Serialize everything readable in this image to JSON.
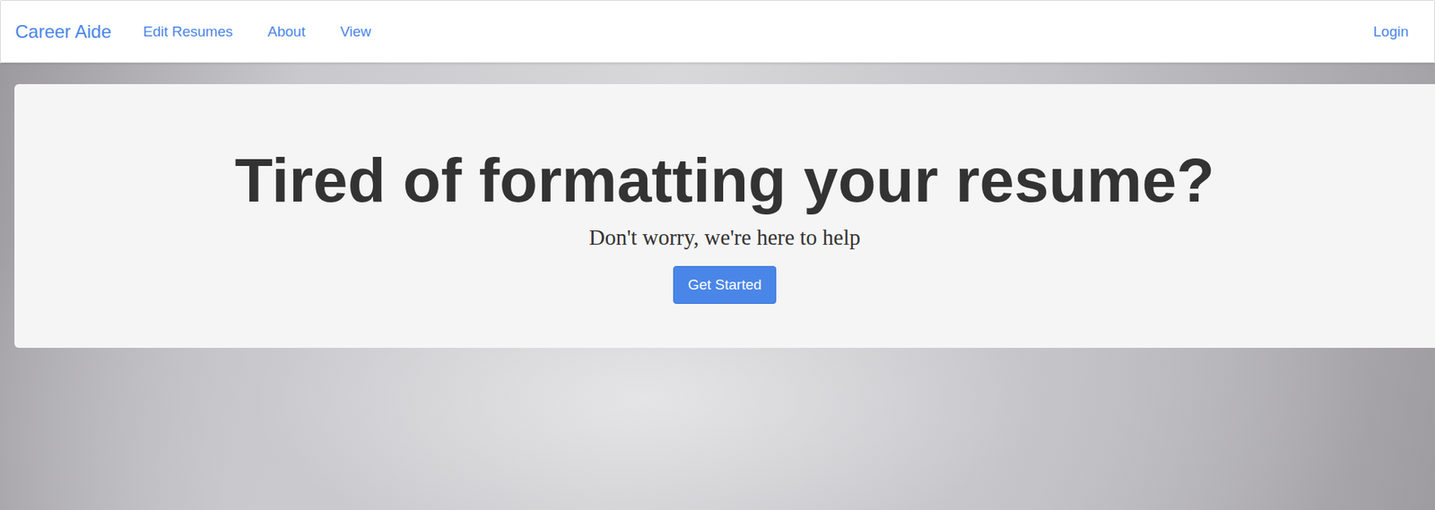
{
  "navbar": {
    "brand": "Career Aide",
    "links": [
      {
        "label": "Edit Resumes"
      },
      {
        "label": "About"
      },
      {
        "label": "View"
      }
    ],
    "login": "Login"
  },
  "hero": {
    "heading": "Tired of formatting your resume?",
    "subheading": "Don't worry, we're here to help",
    "button": "Get Started"
  }
}
